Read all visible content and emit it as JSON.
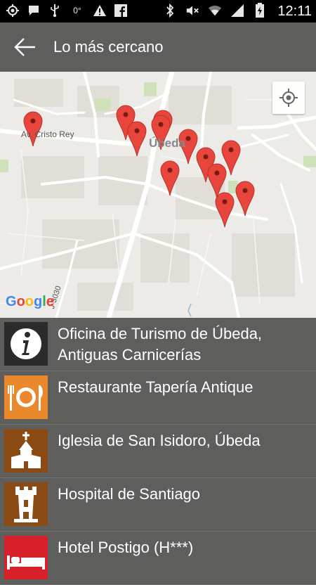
{
  "status_bar": {
    "time": "12:11",
    "temperature": "0°",
    "icons_left": [
      "gps-icon",
      "chat-bubble-icon",
      "usb-icon",
      "temperature-icon",
      "warning-icon",
      "facebook-icon"
    ],
    "icons_right": [
      "bluetooth-icon",
      "mute-icon",
      "wifi-icon",
      "signal-icon",
      "battery-charging-icon"
    ]
  },
  "app_bar": {
    "title": "Lo más cercano",
    "back_icon": "arrow-back-icon"
  },
  "map": {
    "street_label": "Av. Cristo Rey",
    "town_label": "Úbeda",
    "road_label": "J-3030",
    "attribution": "Google",
    "pin_color": "#e8463c",
    "my_location_icon": "my-location-icon",
    "pin_count": 13
  },
  "places": [
    {
      "name": "Oficina de Turismo de Úbeda, Antiguas Carnicerías",
      "icon": "info-icon",
      "icon_bg": "#1f1f1f"
    },
    {
      "name": "Restaurante Tapería Antique",
      "icon": "restaurant-plate-icon",
      "icon_bg": "#e9892c"
    },
    {
      "name": "Iglesia de San Isidoro, Úbeda",
      "icon": "church-icon",
      "icon_bg": "#8a4a13"
    },
    {
      "name": "Hospital de Santiago",
      "icon": "tower-icon",
      "icon_bg": "#8a4a13"
    },
    {
      "name": "Hotel Postigo (H***)",
      "icon": "bed-icon",
      "icon_bg": "#d8202a"
    }
  ],
  "colors": {
    "app_bar": "#5e5e5c",
    "list_background": "#5e5e5c",
    "map_background": "#ecebe7"
  }
}
